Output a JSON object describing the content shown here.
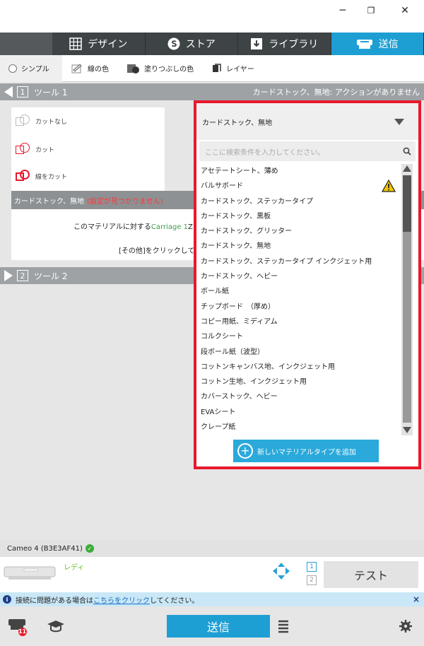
{
  "window": {
    "minimize": "─",
    "maximize": "❐",
    "close": "✕"
  },
  "tabs": [
    {
      "label": "デザイン",
      "icon": "grid-icon"
    },
    {
      "label": "ストア",
      "icon": "store-s-icon"
    },
    {
      "label": "ライブラリ",
      "icon": "library-icon"
    },
    {
      "label": "送信",
      "icon": "cutter-send-icon",
      "active": true
    }
  ],
  "subtabs": [
    "シンプル",
    "線の色",
    "塗りつぶしの色",
    "レイヤー"
  ],
  "tool1": {
    "num": "1",
    "label": "ツール 1",
    "status": "カードストック、無地: アクションがありません"
  },
  "tool2": {
    "num": "2",
    "label": "ツール 2"
  },
  "cut_options": [
    "カットなし",
    "カット",
    "線をカット"
  ],
  "material_bar": {
    "name": "カードストック、無地",
    "warning": "(設定が見つかりません)"
  },
  "material_msg": {
    "line1_prefix": "このマテリアルに対する",
    "line1_link": "Carriage 1",
    "line1_suffix": "Z",
    "line2": "[その他]をクリックして"
  },
  "dropdown": {
    "selected": "カードストック、無地",
    "search_placeholder": "ここに検索条件を入力してください。",
    "items": [
      "アセテートシート、薄め",
      "バルサボード",
      "カードストック、ステッカータイプ",
      "カードストック、黒板",
      "カードストック、グリッター",
      "カードストック、無地",
      "カードストック、ステッカータイプ インクジェット用",
      "カードストック、ヘビー",
      "ボール紙",
      "チップボード　（厚め）",
      "コピー用紙、ミディアム",
      "コルクシート",
      "段ボール紙（波型）",
      "コットンキャンバス地、インクジェット用",
      "コットン生地、インクジェット用",
      "カバーストック、ヘビー",
      "EVAシート",
      "クレープ紙"
    ],
    "add_label": "新しいマテリアルタイプを追加"
  },
  "device": {
    "name": "Cameo 4 (B3E3AF41)",
    "status": "レディ"
  },
  "pages": [
    "1",
    "2"
  ],
  "test_label": "テスト",
  "info": {
    "prefix": "接続に問題がある場合は",
    "link": "こちらをクリック",
    "suffix": "してください。",
    "close": "×"
  },
  "footer": {
    "send_label": "送信",
    "badge": "11"
  },
  "colors": {
    "accent": "#1e9fd4",
    "highlight_border": "#e8192c",
    "warning": "#ff3838"
  }
}
